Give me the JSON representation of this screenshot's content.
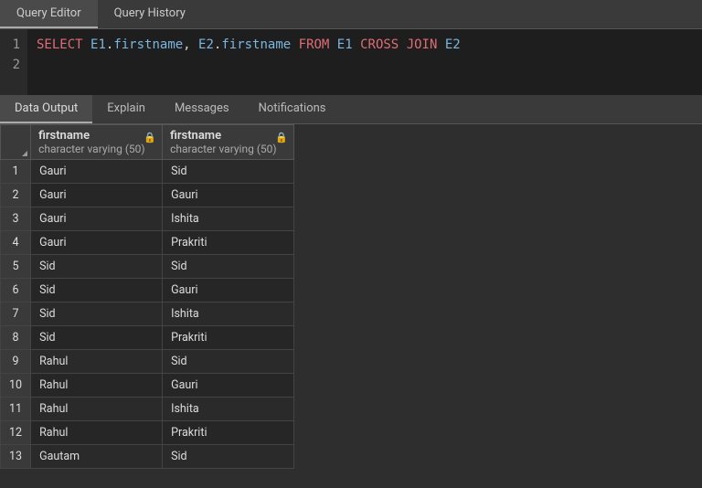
{
  "editorTabs": {
    "queryEditor": "Query Editor",
    "queryHistory": "Query History"
  },
  "lineNumbers": [
    "1",
    "2"
  ],
  "sql": {
    "select": "SELECT",
    "e1": "E1",
    "dot1": ".",
    "fn1": "firstname",
    "comma": ",",
    "sp": " ",
    "e2a": "E2",
    "dot2": ".",
    "fn2": "firstname",
    "from": "FROM",
    "e1b": "E1",
    "cross": "CROSS",
    "join": "JOIN",
    "e2b": "E2"
  },
  "resultTabs": {
    "dataOutput": "Data Output",
    "explain": "Explain",
    "messages": "Messages",
    "notifications": "Notifications"
  },
  "columns": [
    {
      "name": "firstname",
      "type": "character varying (50)"
    },
    {
      "name": "firstname",
      "type": "character varying (50)"
    }
  ],
  "rows": [
    {
      "n": "1",
      "c1": "Gauri",
      "c2": "Sid"
    },
    {
      "n": "2",
      "c1": "Gauri",
      "c2": "Gauri"
    },
    {
      "n": "3",
      "c1": "Gauri",
      "c2": "Ishita"
    },
    {
      "n": "4",
      "c1": "Gauri",
      "c2": "Prakriti"
    },
    {
      "n": "5",
      "c1": "Sid",
      "c2": "Sid"
    },
    {
      "n": "6",
      "c1": "Sid",
      "c2": "Gauri"
    },
    {
      "n": "7",
      "c1": "Sid",
      "c2": "Ishita"
    },
    {
      "n": "8",
      "c1": "Sid",
      "c2": "Prakriti"
    },
    {
      "n": "9",
      "c1": "Rahul",
      "c2": "Sid"
    },
    {
      "n": "10",
      "c1": "Rahul",
      "c2": "Gauri"
    },
    {
      "n": "11",
      "c1": "Rahul",
      "c2": "Ishita"
    },
    {
      "n": "12",
      "c1": "Rahul",
      "c2": "Prakriti"
    },
    {
      "n": "13",
      "c1": "Gautam",
      "c2": "Sid"
    }
  ]
}
